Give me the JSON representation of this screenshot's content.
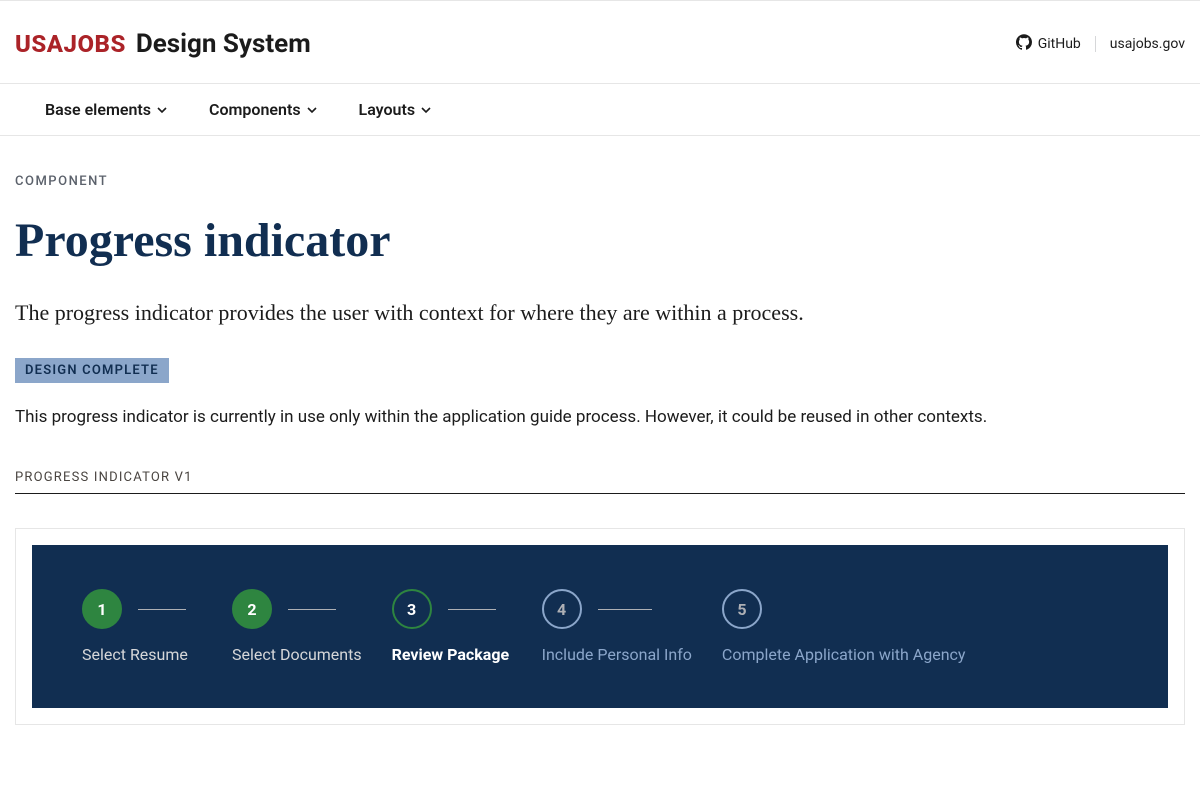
{
  "header": {
    "logo_brand": "USAJOBS",
    "logo_suffix": "Design System",
    "github_label": "GitHub",
    "site_link_label": "usajobs.gov"
  },
  "nav": {
    "items": [
      {
        "label": "Base elements"
      },
      {
        "label": "Components"
      },
      {
        "label": "Layouts"
      }
    ]
  },
  "page": {
    "eyebrow": "COMPONENT",
    "title": "Progress indicator",
    "lead": "The progress indicator provides the user with context for where they are within a process.",
    "badge": "DESIGN COMPLETE",
    "body": "This progress indicator is currently in use only within the application guide process. However, it could be reused in other contexts.",
    "section_label": "PROGRESS INDICATOR V1"
  },
  "progress": {
    "steps": [
      {
        "num": "1",
        "label": "Select Resume",
        "state": "completed"
      },
      {
        "num": "2",
        "label": "Select Documents",
        "state": "completed"
      },
      {
        "num": "3",
        "label": "Review Package",
        "state": "current"
      },
      {
        "num": "4",
        "label": "Include Personal Info",
        "state": "upcoming"
      },
      {
        "num": "5",
        "label": "Complete Application with Agency",
        "state": "upcoming"
      }
    ]
  }
}
